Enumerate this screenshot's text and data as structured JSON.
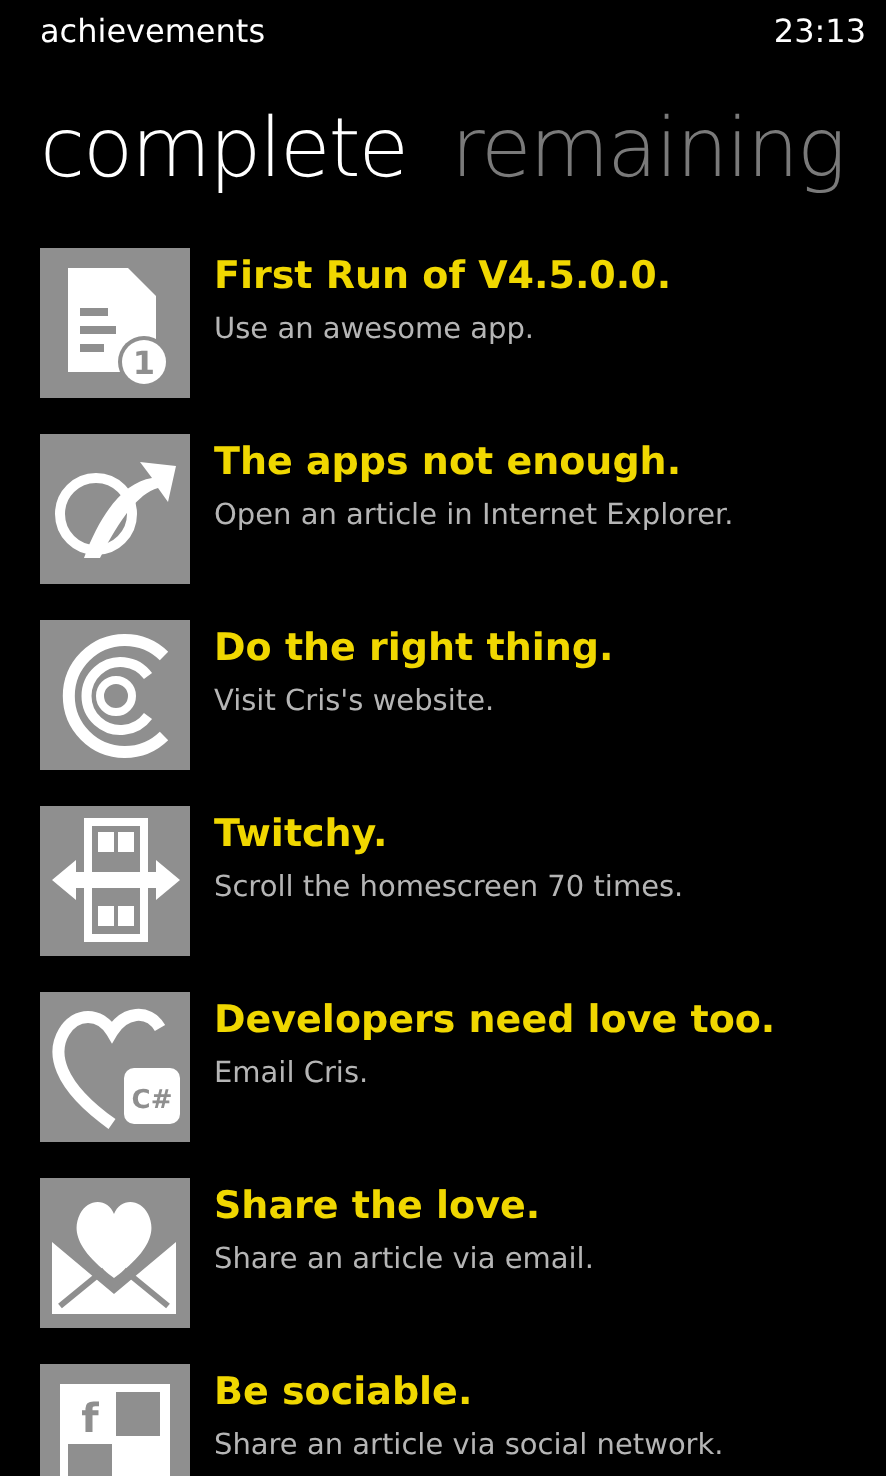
{
  "status_bar": {
    "title": "achievements",
    "time": "23:13"
  },
  "pivot": [
    {
      "label": "complete",
      "selected": true
    },
    {
      "label": "remaining",
      "selected": false
    }
  ],
  "achievements": [
    {
      "kind": "document",
      "icon_label": "1",
      "title": "First Run of V4.5.0.0.",
      "description": "Use an awesome app."
    },
    {
      "kind": "globe",
      "title": "The apps not enough.",
      "description": "Open an article in Internet Explorer."
    },
    {
      "kind": "rings",
      "title": "Do the right thing.",
      "description": "Visit Cris's website."
    },
    {
      "kind": "scroll",
      "title": "Twitchy.",
      "description": "Scroll the homescreen 70 times."
    },
    {
      "kind": "heart-code",
      "icon_label": "C#",
      "title": "Developers need love too.",
      "description": "Email Cris."
    },
    {
      "kind": "heart-mail",
      "title": "Share the love.",
      "description": "Share an article via email."
    },
    {
      "kind": "social",
      "icon_label": "f",
      "title": "Be sociable.",
      "description": "Share an article via social network."
    }
  ]
}
